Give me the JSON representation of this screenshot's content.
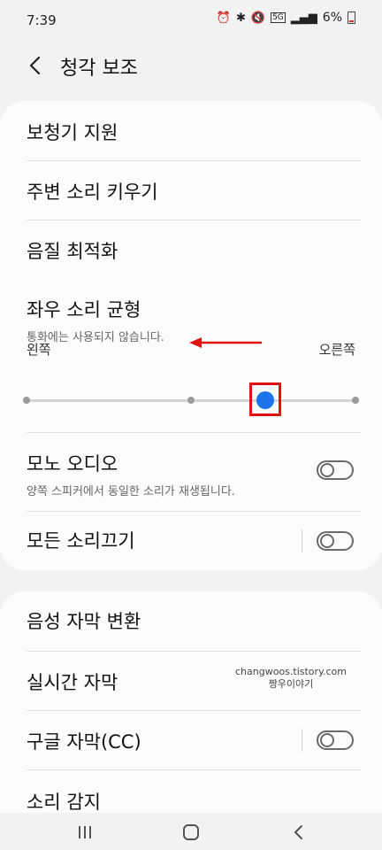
{
  "status_bar": {
    "time": "7:39",
    "battery_text": "6%",
    "network_badge": "5G",
    "icons": [
      "alarm-icon",
      "bluetooth-icon",
      "mute-icon",
      "5g-icon",
      "signal-icon",
      "battery-icon"
    ]
  },
  "header": {
    "title": "청각 보조",
    "back_icon": "back-arrow-icon"
  },
  "section1": {
    "hearing_aid": "보청기 지원",
    "amplify_ambient": "주변 소리 키우기",
    "sound_optimization": "음질 최적화",
    "balance": {
      "title": "좌우 소리 균형",
      "subtitle": "통화에는 사용되지 않습니다.",
      "left_label": "왼쪽",
      "right_label": "오른쪽",
      "value_fraction": 0.7
    },
    "mono_audio": {
      "title": "모노 오디오",
      "subtitle": "양쪽 스피커에서 동일한 소리가 재생됩니다.",
      "enabled": false
    },
    "mute_all": {
      "title": "모든 소리끄기",
      "enabled": false
    }
  },
  "section2": {
    "speech_to_text": "음성 자막 변환",
    "live_caption": "실시간 자막",
    "google_caption": {
      "title": "구글 자막(CC)",
      "enabled": false
    },
    "partial_item": "소리 감지"
  },
  "watermark": {
    "line1": "changwoos.tistory.com",
    "line2": "짱우이야기"
  },
  "annotation_color": "#e01111",
  "accent_color": "#1a73e8",
  "navbar": {
    "icons": [
      "recents-icon",
      "home-icon",
      "back-icon"
    ]
  }
}
